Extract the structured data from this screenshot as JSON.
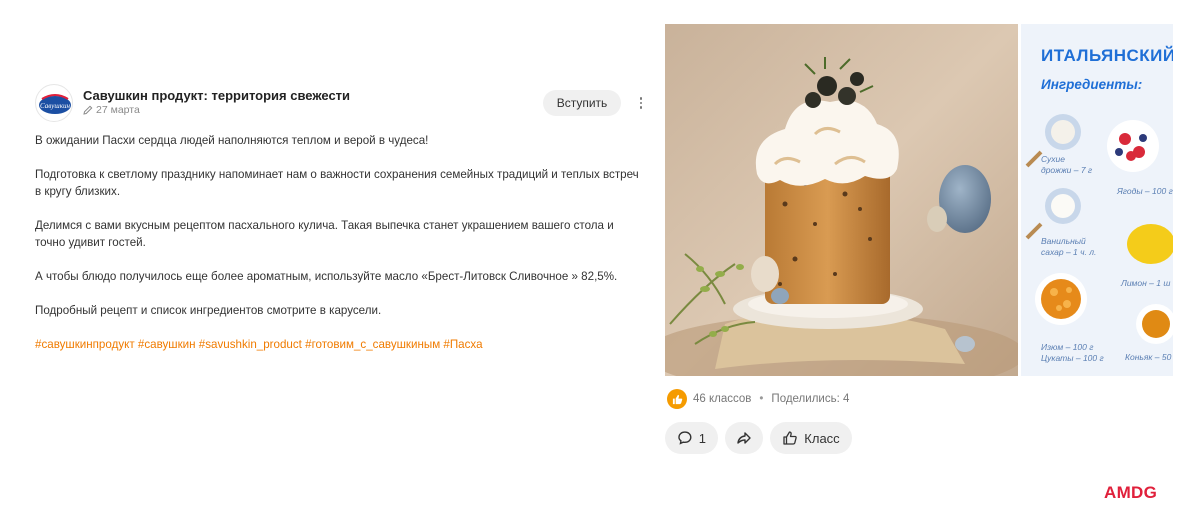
{
  "post": {
    "group_name": "Савушкин продукт: территория свежести",
    "avatar_text": "Савушкин",
    "date": "27 марта",
    "join_label": "Вступить",
    "paragraphs": [
      "В ожидании Пасхи сердца людей наполняются теплом и верой в чудеса!",
      "Подготовка к светлому празднику напоминает нам о важности сохранения семейных традиций и теплых встреч в кругу близких.",
      "Делимся с вами вкусным рецептом пасхального кулича. Такая выпечка станет украшением вашего стола и точно удивит гостей.",
      "А чтобы блюдо получилось еще более ароматным, используйте масло «Брест-Литовск Сливочное » 82,5%.",
      "Подробный рецепт и список ингредиентов смотрите в карусели."
    ],
    "hashtags": [
      "#савушкинпродукт",
      "#савушкин",
      "#savushkin_product",
      "#готовим_с_савушкиным",
      "#Пасха"
    ]
  },
  "carousel": {
    "second_slide": {
      "title": "ИТАЛЬЯНСКИЙ",
      "subtitle": "Ингредиенты:",
      "ingredients": [
        {
          "line1": "Сухие",
          "line2": "дрожжи – 7 г"
        },
        {
          "line1": "Ягоды – 100 г",
          "line2": ""
        },
        {
          "line1": "Ванильный",
          "line2": "сахар – 1 ч. л."
        },
        {
          "line1": "Лимон – 1 ш",
          "line2": ""
        },
        {
          "line1": "Изюм – 100 г",
          "line2": "Цукаты – 100 г"
        },
        {
          "line1": "Коньяк – 50",
          "line2": ""
        }
      ]
    }
  },
  "stats": {
    "likes": "46 классов",
    "separator": "•",
    "shares": "Поделились: 4"
  },
  "actions": {
    "comments_count": "1",
    "klass_label": "Класс"
  },
  "brand": {
    "logo_text": "AMDG",
    "accent_color": "#f07b00",
    "brand_color": "#e0203b"
  },
  "icons": [
    "pencil-icon",
    "more-vertical-icon",
    "like-icon",
    "comment-icon",
    "share-icon",
    "thumb-up-icon"
  ]
}
